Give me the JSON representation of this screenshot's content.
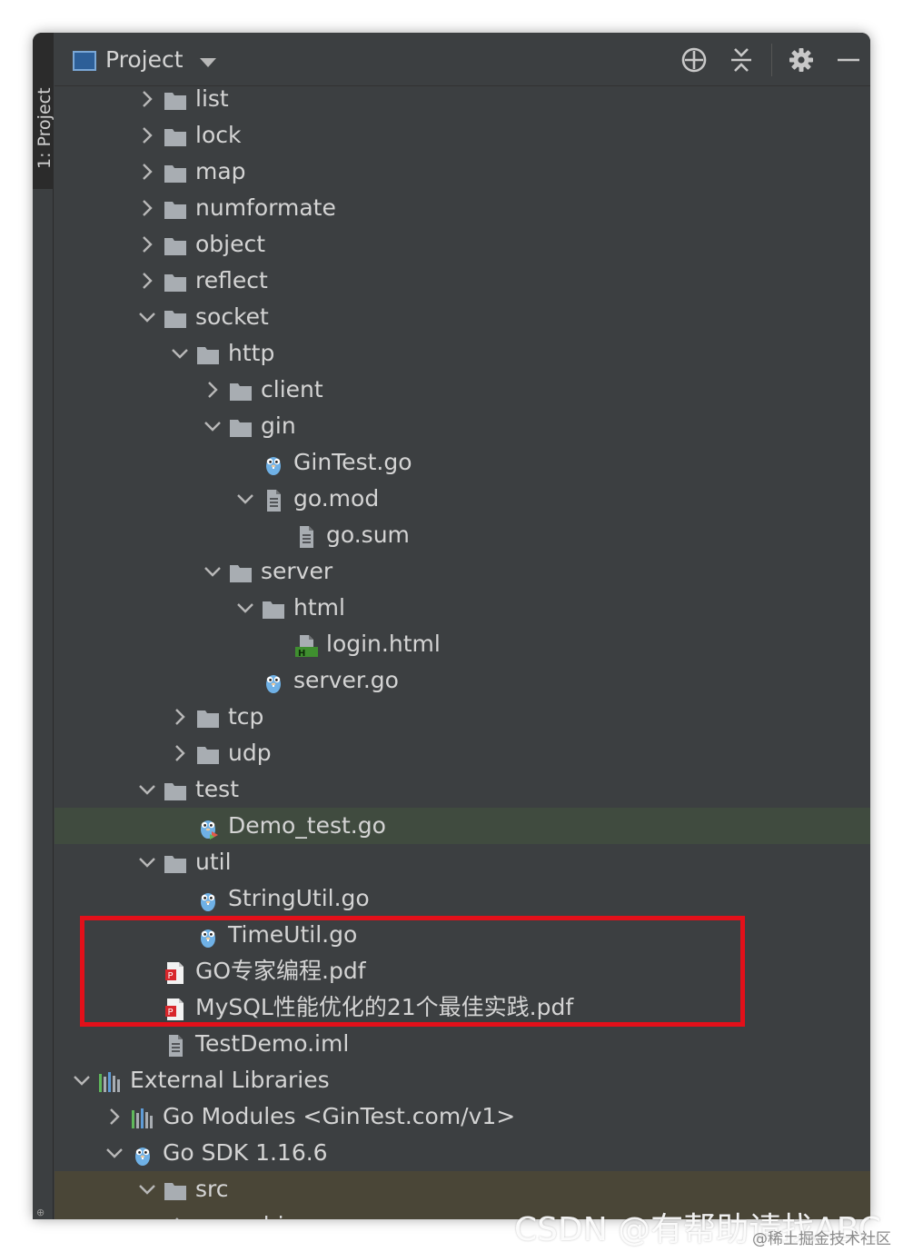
{
  "sidebar": {
    "tab_label": "1: Project"
  },
  "header": {
    "title": "Project",
    "tools": [
      "locate-icon",
      "collapse-all-icon",
      "gear-icon",
      "minimize-icon"
    ]
  },
  "tree": [
    {
      "label": "list",
      "icon": "folder",
      "arrow": "right",
      "depth": 2
    },
    {
      "label": "lock",
      "icon": "folder",
      "arrow": "right",
      "depth": 2
    },
    {
      "label": "map",
      "icon": "folder",
      "arrow": "right",
      "depth": 2
    },
    {
      "label": "numformate",
      "icon": "folder",
      "arrow": "right",
      "depth": 2
    },
    {
      "label": "object",
      "icon": "folder",
      "arrow": "right",
      "depth": 2
    },
    {
      "label": "reflect",
      "icon": "folder",
      "arrow": "right",
      "depth": 2
    },
    {
      "label": "socket",
      "icon": "folder",
      "arrow": "down",
      "depth": 2
    },
    {
      "label": "http",
      "icon": "folder",
      "arrow": "down",
      "depth": 3
    },
    {
      "label": "client",
      "icon": "folder",
      "arrow": "right",
      "depth": 4
    },
    {
      "label": "gin",
      "icon": "folder",
      "arrow": "down",
      "depth": 4
    },
    {
      "label": "GinTest.go",
      "icon": "gopher",
      "arrow": "none",
      "depth": 5
    },
    {
      "label": "go.mod",
      "icon": "textfile",
      "arrow": "down",
      "depth": 5
    },
    {
      "label": "go.sum",
      "icon": "textfile",
      "arrow": "none",
      "depth": 6
    },
    {
      "label": "server",
      "icon": "folder",
      "arrow": "down",
      "depth": 4
    },
    {
      "label": "html",
      "icon": "folder",
      "arrow": "down",
      "depth": 5
    },
    {
      "label": "login.html",
      "icon": "htmlfile",
      "arrow": "none",
      "depth": 6
    },
    {
      "label": "server.go",
      "icon": "gopher",
      "arrow": "none",
      "depth": 5
    },
    {
      "label": "tcp",
      "icon": "folder",
      "arrow": "right",
      "depth": 3
    },
    {
      "label": "udp",
      "icon": "folder",
      "arrow": "right",
      "depth": 3
    },
    {
      "label": "test",
      "icon": "folder",
      "arrow": "down",
      "depth": 2
    },
    {
      "label": "Demo_test.go",
      "icon": "gopher-test",
      "arrow": "none",
      "depth": 3,
      "selected": true
    },
    {
      "label": "util",
      "icon": "folder",
      "arrow": "down",
      "depth": 2
    },
    {
      "label": "StringUtil.go",
      "icon": "gopher",
      "arrow": "none",
      "depth": 3
    },
    {
      "label": "TimeUtil.go",
      "icon": "gopher",
      "arrow": "none",
      "depth": 3
    },
    {
      "label": "GO专家编程.pdf",
      "icon": "pdf",
      "arrow": "none",
      "depth": 2
    },
    {
      "label": "MySQL性能优化的21个最佳实践.pdf",
      "icon": "pdf",
      "arrow": "none",
      "depth": 2
    },
    {
      "label": "TestDemo.iml",
      "icon": "textfile",
      "arrow": "none",
      "depth": 2
    },
    {
      "label": "External Libraries",
      "icon": "library",
      "arrow": "down",
      "depth": 0
    },
    {
      "label": "Go Modules <GinTest.com/v1>",
      "icon": "library",
      "arrow": "right",
      "depth": 1
    },
    {
      "label": "Go SDK 1.16.6",
      "icon": "gopher",
      "arrow": "down",
      "depth": 1
    },
    {
      "label": "src",
      "icon": "folder",
      "arrow": "down",
      "depth": 2,
      "lib": true
    },
    {
      "label": "archive",
      "icon": "folder",
      "arrow": "right",
      "depth": 3,
      "lib": true
    }
  ],
  "highlight": {
    "color": "#e3101a"
  },
  "watermark": {
    "main": "CSDN @有帮助请找ABC",
    "sub": "@稀土掘金技术社区"
  },
  "colors": {
    "panel_bg": "#3c3f41",
    "text": "#d4d4d4",
    "folder": "#a8adb2",
    "selection": "#404b3f",
    "library_row": "#4a4637"
  }
}
